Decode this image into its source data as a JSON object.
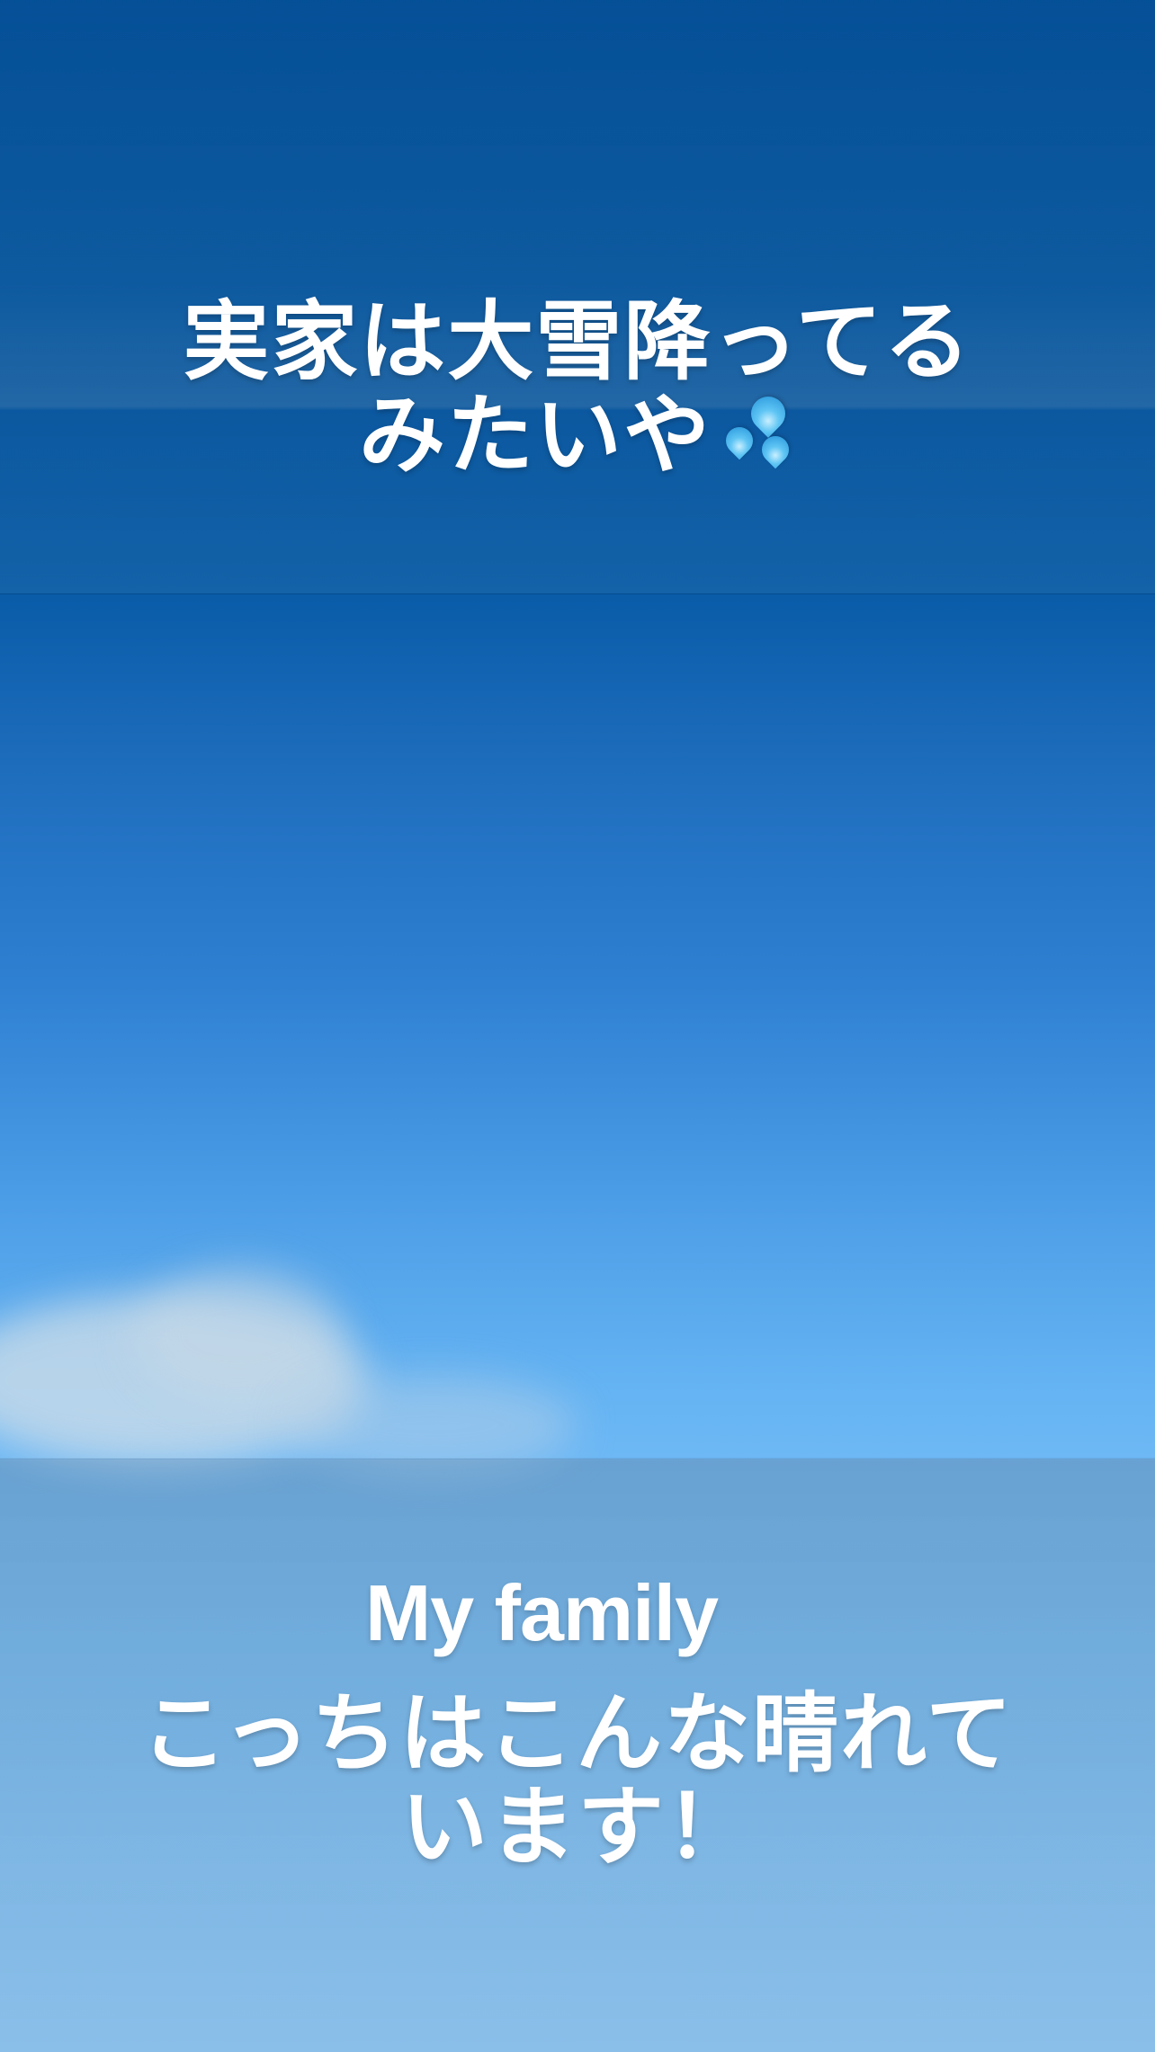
{
  "story": {
    "top_caption": {
      "line1": "実家は大雪降ってる",
      "line2": "みたいや"
    },
    "emoji": "sweat-droplets-icon",
    "english_label": "My family",
    "bottom_caption": {
      "line1": "こっちはこんな晴れて",
      "line2": "います！"
    }
  }
}
